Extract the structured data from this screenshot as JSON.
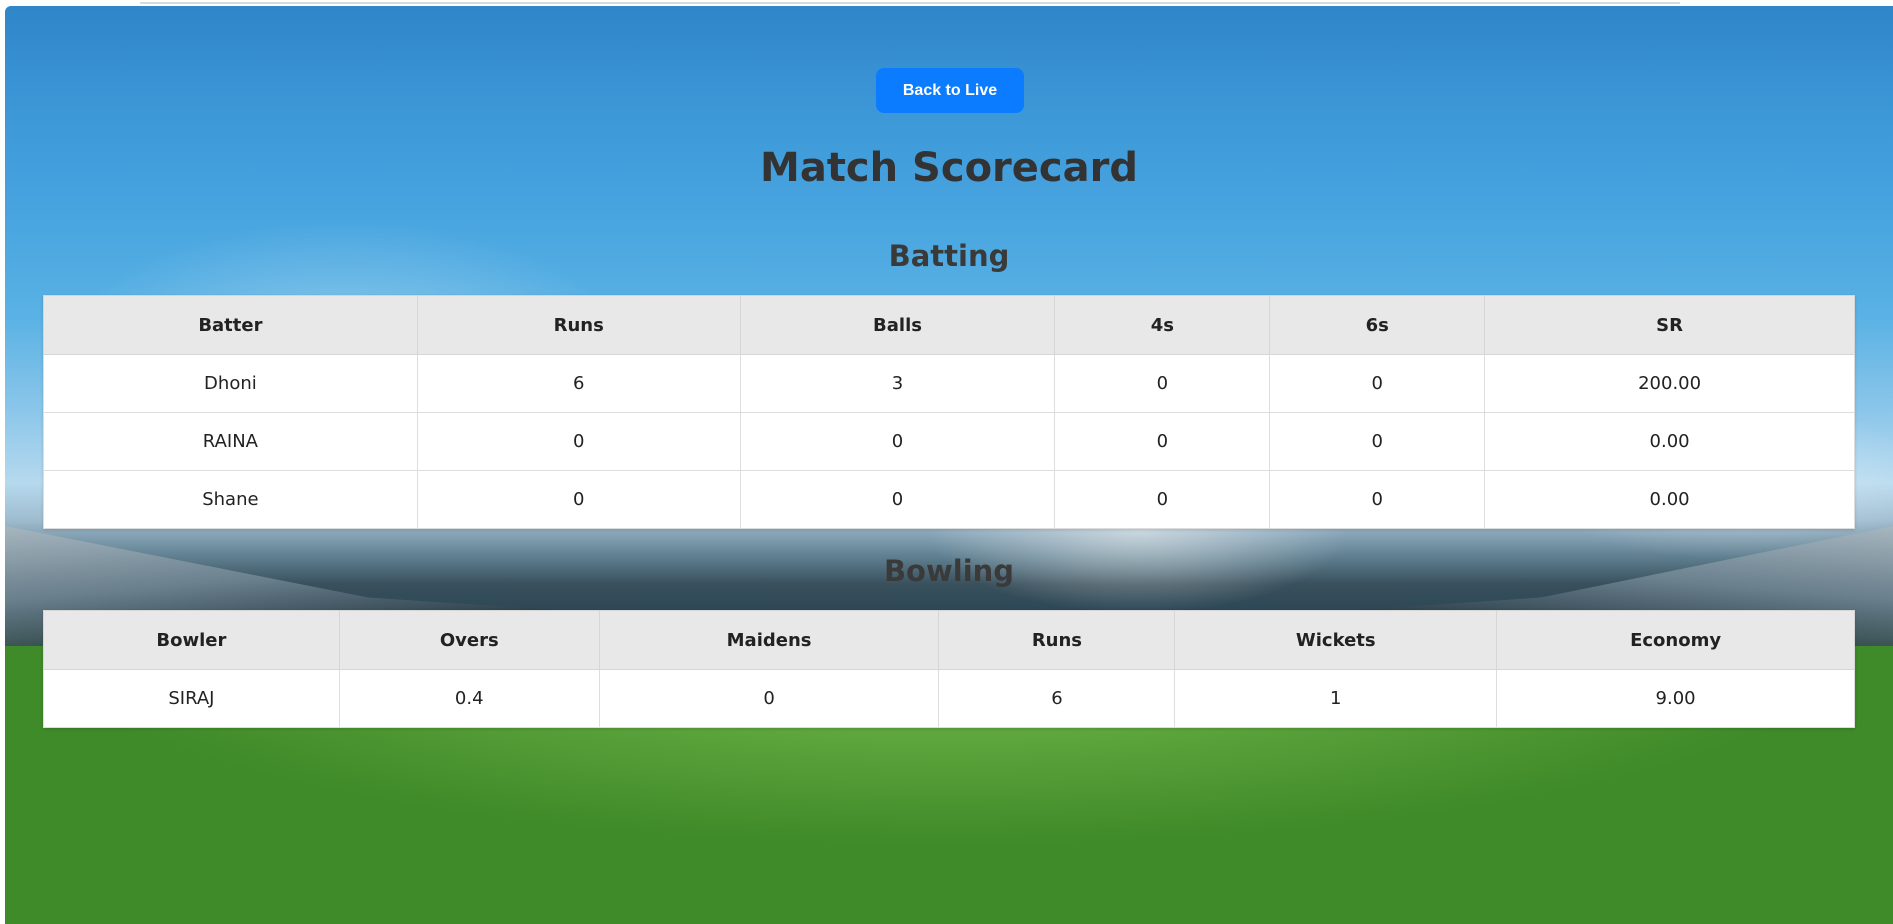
{
  "back_button": {
    "label": "Back to Live"
  },
  "page_title": "Match Scorecard",
  "batting": {
    "title": "Batting",
    "headers": [
      "Batter",
      "Runs",
      "Balls",
      "4s",
      "6s",
      "SR"
    ],
    "rows": [
      [
        "Dhoni",
        "6",
        "3",
        "0",
        "0",
        "200.00"
      ],
      [
        "RAINA",
        "0",
        "0",
        "0",
        "0",
        "0.00"
      ],
      [
        "Shane",
        "0",
        "0",
        "0",
        "0",
        "0.00"
      ]
    ]
  },
  "bowling": {
    "title": "Bowling",
    "headers": [
      "Bowler",
      "Overs",
      "Maidens",
      "Runs",
      "Wickets",
      "Economy"
    ],
    "rows": [
      [
        "SIRAJ",
        "0.4",
        "0",
        "6",
        "1",
        "9.00"
      ]
    ]
  },
  "colors": {
    "button": "#0b7bff",
    "title_text": "#333333",
    "table_header_bg": "#e8e8e8",
    "table_bg": "#ffffff"
  },
  "background": "cricket-stadium-image"
}
